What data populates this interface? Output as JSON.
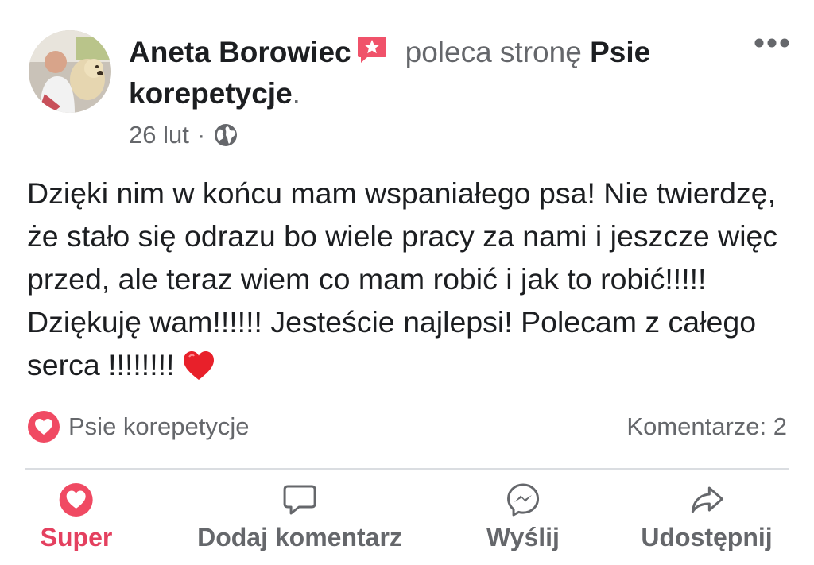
{
  "post": {
    "author": "Aneta Borowiec",
    "action_text": "poleca stronę",
    "page": "Psie korepetycje",
    "period": ".",
    "date": "26 lut",
    "separator": "·",
    "privacy_icon": "globe-icon",
    "text": "Dzięki nim w końcu mam wspaniałego psa! Nie twierdzę, że stało się odrazu bo wiele pracy za nami i jeszcze więc przed, ale teraz wiem co mam robić i jak to robić!!!!! Dziękuję wam!!!!!! Jesteście najlepsi! Polecam z całego serca !!!!!!!!"
  },
  "reactions": {
    "icon": "love-reaction-icon",
    "label": "Psie korepetycje"
  },
  "comments": {
    "label": "Komentarze: 2"
  },
  "actions": {
    "super": "Super",
    "comment": "Dodaj komentarz",
    "send": "Wyślij",
    "share": "Udostępnij"
  },
  "colors": {
    "accent": "#e4405f",
    "text": "#1c1e21",
    "muted": "#65676b",
    "divider": "#dadde1"
  }
}
